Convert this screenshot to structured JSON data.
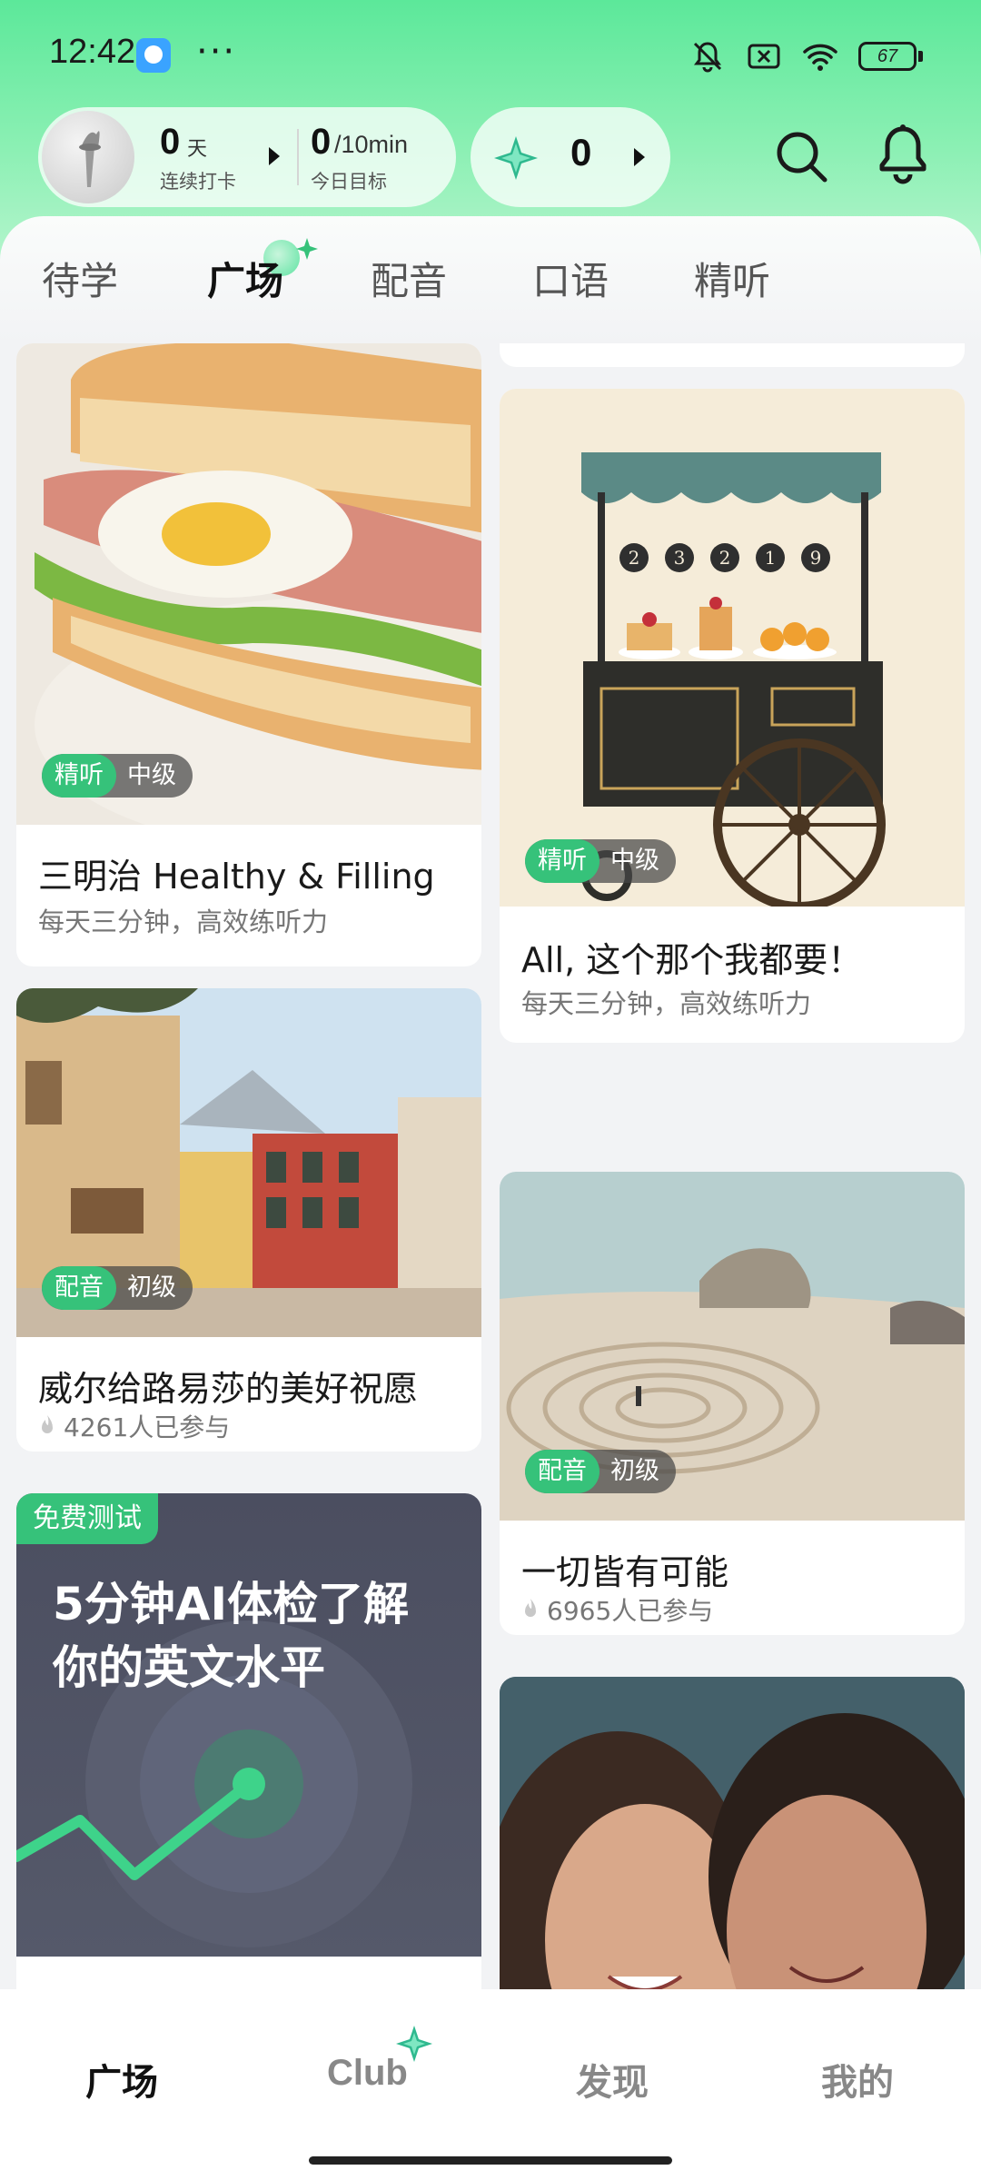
{
  "status_bar": {
    "time": "12:42",
    "dots": "···",
    "battery": "67"
  },
  "header": {
    "streak": {
      "value": "0",
      "unit": "天",
      "label": "连续打卡"
    },
    "goal": {
      "value": "0",
      "unit": "/10min",
      "label": "今日目标"
    },
    "gems": {
      "count": "0"
    }
  },
  "tabs": [
    {
      "label": "待学",
      "active": false
    },
    {
      "label": "广场",
      "active": true
    },
    {
      "label": "配音",
      "active": false
    },
    {
      "label": "口语",
      "active": false
    },
    {
      "label": "精听",
      "active": false
    }
  ],
  "feed": {
    "left": [
      {
        "title": "三明治 Healthy & Filling",
        "subtitle": "每天三分钟，高效练听力",
        "badge_type": "精听",
        "badge_level": "中级"
      },
      {
        "title": "威尔给路易莎的美好祝愿",
        "participants": "4261人已参与",
        "badge_type": "配音",
        "badge_level": "初级"
      },
      {
        "free_tag": "免费测试",
        "promo_line1": "5分钟AI体检了解",
        "promo_line2": "你的英文水平"
      }
    ],
    "right": [
      {
        "title": "All, 这个那个我都要！",
        "subtitle": "每天三分钟，高效练听力",
        "badge_type": "精听",
        "badge_level": "中级",
        "cart_numbers": [
          "2",
          "3",
          "2",
          "1",
          "9"
        ]
      },
      {
        "title": "一切皆有可能",
        "participants": "6965人已参与",
        "badge_type": "配音",
        "badge_level": "初级"
      },
      {
        "title": ""
      }
    ]
  },
  "bottom_nav": [
    {
      "label": "广场",
      "active": true
    },
    {
      "label": "Club",
      "active": false
    },
    {
      "label": "发现",
      "active": false
    },
    {
      "label": "我的",
      "active": false
    }
  ],
  "colors": {
    "accent_green": "#36c27a",
    "header_gradient_top": "#5ce89a",
    "badge_dark": "#464646"
  },
  "icons": [
    "muted-bell-icon",
    "no-sim-icon",
    "wifi-icon",
    "battery-icon",
    "torch-icon",
    "gem-icon",
    "search-icon",
    "bell-icon",
    "sparkle-icon",
    "flame-icon"
  ]
}
